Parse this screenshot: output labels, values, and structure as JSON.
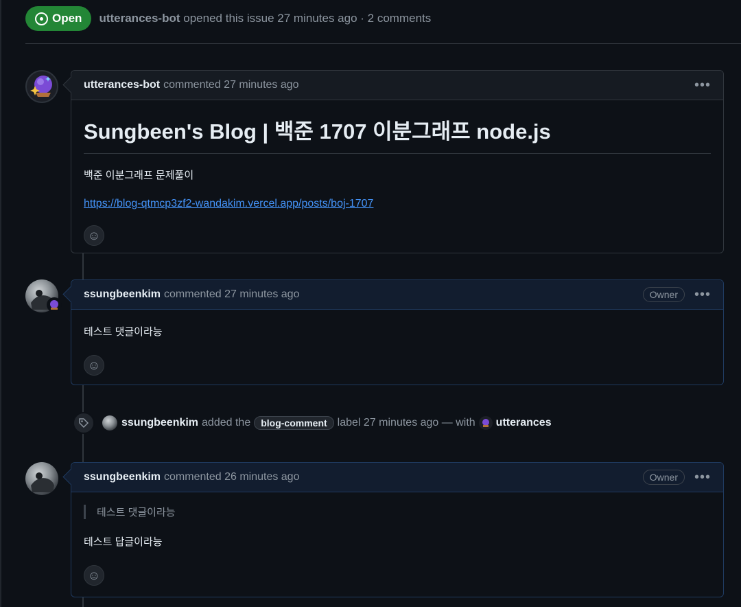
{
  "issue": {
    "state_label": "Open",
    "author": "utterances-bot",
    "meta_text": "opened this issue 27 minutes ago · 2 comments"
  },
  "comments": [
    {
      "author": "utterances-bot",
      "meta": "commented 27 minutes ago",
      "title": "Sungbeen's Blog | 백준 1707 이분그래프 node.js",
      "text": "백준 이분그래프 문제풀이",
      "link": "https://blog-qtmcp3zf2-wandakim.vercel.app/posts/boj-1707"
    },
    {
      "author": "ssungbeenkim",
      "meta": "commented 27 minutes ago",
      "badge": "Owner",
      "text": "테스트 댓글이라능"
    },
    {
      "author": "ssungbeenkim",
      "meta": "commented 26 minutes ago",
      "badge": "Owner",
      "quote": "테스트 댓글이라능",
      "text": "테스트 답글이라능"
    }
  ],
  "label_event": {
    "actor": "ssungbeenkim",
    "action": "added the",
    "label": "blog-comment",
    "meta": "label 27 minutes ago — with",
    "app": "utterances"
  },
  "icons": {
    "state": "issue-opened-icon",
    "more": "kebab-horizontal-icon",
    "reaction": "smiley-icon",
    "tag": "tag-icon"
  },
  "colors": {
    "open_green": "#238636",
    "link_blue": "#4493f8",
    "owner_border": "#1f3a5f"
  }
}
